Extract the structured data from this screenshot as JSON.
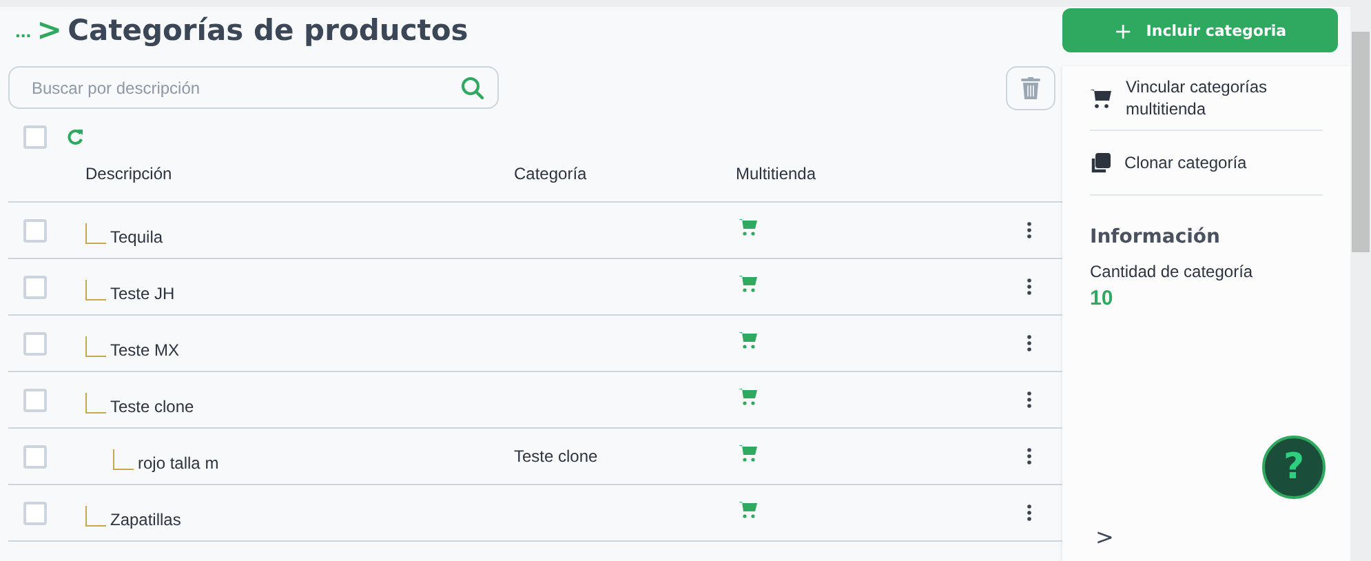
{
  "breadcrumb": {
    "ellipsis": "...",
    "separator": ">"
  },
  "title": "Categorías de productos",
  "add_button": {
    "icon": "+",
    "label": "Incluir categoria"
  },
  "search": {
    "placeholder": "Buscar por descripción"
  },
  "select_all": {
    "checked": false
  },
  "table": {
    "columns": [
      "Descripción",
      "Categoría",
      "Multitienda"
    ],
    "rows": [
      {
        "description": "Tequila",
        "category": "",
        "multistore": true,
        "checked": false
      },
      {
        "description": "Teste JH",
        "category": "",
        "multistore": true,
        "checked": false
      },
      {
        "description": "Teste MX",
        "category": "",
        "multistore": true,
        "checked": false
      },
      {
        "description": "Teste clone",
        "category": "",
        "multistore": true,
        "checked": false,
        "children": [
          {
            "description": "rojo talla m",
            "category": "Teste clone",
            "multistore": true,
            "checked": false
          }
        ]
      },
      {
        "description": "Zapatillas",
        "category": "",
        "multistore": true,
        "checked": false
      }
    ]
  },
  "actions": [
    {
      "kind": "cart",
      "label": "Vincular categorías multitienda"
    },
    {
      "kind": "clone",
      "label": "Clonar categoría"
    }
  ],
  "info": {
    "title": "Información",
    "label": "Cantidad de categoría",
    "value": "10"
  },
  "help_button": {
    "label": "?"
  },
  "collapse_toggle": {
    "label": ">"
  }
}
